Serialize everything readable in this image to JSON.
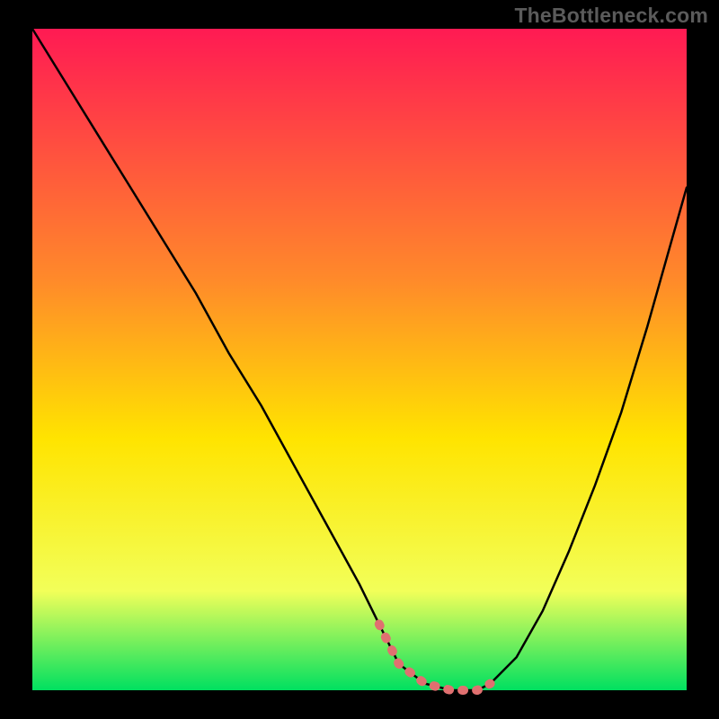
{
  "watermark": "TheBottleneck.com",
  "chart_data": {
    "type": "line",
    "title": "",
    "xlabel": "",
    "ylabel": "",
    "xlim": [
      0,
      100
    ],
    "ylim": [
      0,
      100
    ],
    "grid": false,
    "legend": false,
    "annotations": [],
    "series": [
      {
        "name": "curve",
        "color": "#000000",
        "x": [
          0,
          5,
          10,
          15,
          20,
          25,
          30,
          35,
          40,
          45,
          50,
          53,
          56,
          60,
          64,
          68,
          70,
          74,
          78,
          82,
          86,
          90,
          94,
          98,
          100
        ],
        "y": [
          100,
          92,
          84,
          76,
          68,
          60,
          51,
          43,
          34,
          25,
          16,
          10,
          4,
          1,
          0,
          0,
          1,
          5,
          12,
          21,
          31,
          42,
          55,
          69,
          76
        ]
      }
    ],
    "flat_region": {
      "name": "optimal-range",
      "color": "#e07070",
      "x": [
        53,
        56,
        60,
        64,
        68,
        70
      ],
      "y": [
        10,
        4,
        1,
        0,
        0,
        1
      ]
    },
    "background_gradient": {
      "top": "#ff1a53",
      "mid1": "#ff8a2a",
      "mid2": "#ffe400",
      "low": "#f2ff59",
      "bottom": "#00e060"
    }
  }
}
